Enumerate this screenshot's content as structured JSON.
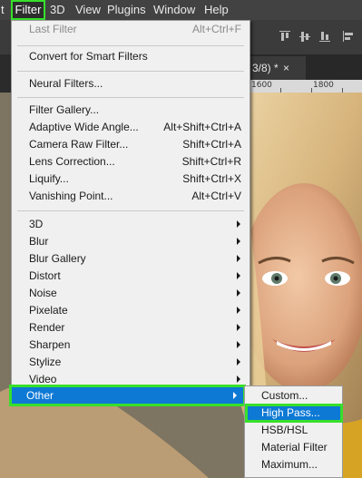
{
  "menubar": {
    "items": [
      {
        "label": "t"
      },
      {
        "label": "Filter"
      },
      {
        "label": "3D"
      },
      {
        "label": "View"
      },
      {
        "label": "Plugins"
      },
      {
        "label": "Window"
      },
      {
        "label": "Help"
      }
    ]
  },
  "document": {
    "tab_label": "3/8) *",
    "close_glyph": "×",
    "ruler_labels": [
      "1600",
      "1800"
    ]
  },
  "filter_menu": {
    "items": [
      {
        "label": "Last Filter",
        "shortcut": "Alt+Ctrl+F",
        "disabled": true
      },
      {
        "label": "Convert for Smart Filters",
        "shortcut": ""
      },
      {
        "label": "Neural Filters...",
        "shortcut": ""
      },
      {
        "label": "Filter Gallery...",
        "shortcut": ""
      },
      {
        "label": "Adaptive Wide Angle...",
        "shortcut": "Alt+Shift+Ctrl+A"
      },
      {
        "label": "Camera Raw Filter...",
        "shortcut": "Shift+Ctrl+A"
      },
      {
        "label": "Lens Correction...",
        "shortcut": "Shift+Ctrl+R"
      },
      {
        "label": "Liquify...",
        "shortcut": "Shift+Ctrl+X"
      },
      {
        "label": "Vanishing Point...",
        "shortcut": "Alt+Ctrl+V"
      },
      {
        "label": "3D"
      },
      {
        "label": "Blur"
      },
      {
        "label": "Blur Gallery"
      },
      {
        "label": "Distort"
      },
      {
        "label": "Noise"
      },
      {
        "label": "Pixelate"
      },
      {
        "label": "Render"
      },
      {
        "label": "Sharpen"
      },
      {
        "label": "Stylize"
      },
      {
        "label": "Video"
      },
      {
        "label": "Other"
      }
    ]
  },
  "other_submenu": {
    "items": [
      {
        "label": "Custom..."
      },
      {
        "label": "High Pass..."
      },
      {
        "label": "HSB/HSL"
      },
      {
        "label": "Material Filter"
      },
      {
        "label": "Maximum..."
      }
    ]
  },
  "colors": {
    "highlight": "#0d79d5",
    "callout": "#37e02a",
    "menu_bg": "#f0f0f0",
    "menubar_bg": "#424242"
  }
}
